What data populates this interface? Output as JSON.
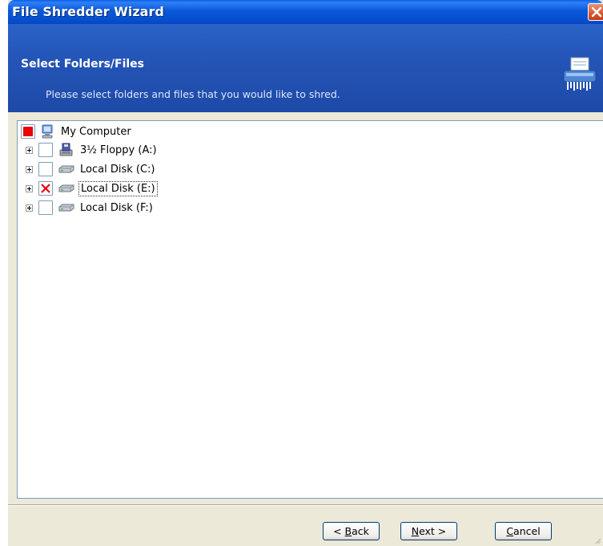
{
  "window": {
    "title": "File Shredder Wizard"
  },
  "banner": {
    "title": "Select Folders/Files",
    "subtitle": "Please select folders and files that you would like to shred.",
    "icon": "shredder-icon"
  },
  "tree": {
    "root": {
      "label": "My Computer",
      "check_state": "partial",
      "icon": "computer-icon"
    },
    "items": [
      {
        "label": "3½ Floppy (A:)",
        "check_state": "unchecked",
        "icon": "floppy-drive-icon",
        "expanded": false
      },
      {
        "label": "Local Disk (C:)",
        "check_state": "unchecked",
        "icon": "hard-disk-icon",
        "expanded": false
      },
      {
        "label": "Local Disk (E:)",
        "check_state": "checked-x",
        "icon": "hard-disk-icon",
        "expanded": false,
        "focused": true
      },
      {
        "label": "Local Disk (F:)",
        "check_state": "unchecked",
        "icon": "hard-disk-icon",
        "expanded": false
      }
    ]
  },
  "buttons": {
    "back": {
      "label": "< Back",
      "accel": "B"
    },
    "next": {
      "label": "Next >",
      "accel": "N"
    },
    "cancel": {
      "label": "Cancel",
      "accel": "C"
    }
  },
  "colors": {
    "title_bar": "#0A58DA",
    "banner": "#2456B8",
    "partial_check": "#E8040A",
    "x_mark": "#E8040A",
    "face": "#ECE9D8"
  }
}
